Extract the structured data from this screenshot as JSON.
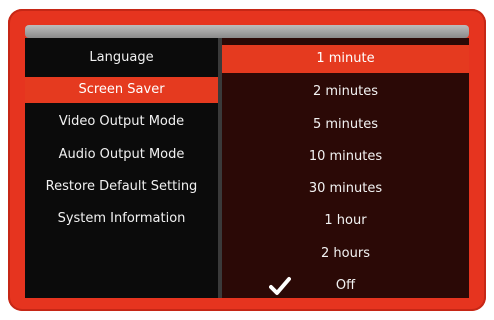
{
  "colors": {
    "frame": "#e6341f",
    "highlight": "#e53a1f",
    "left_panel": "#0b0b0b",
    "right_panel": "#2b0906",
    "text": "#f1f1f1"
  },
  "menu": {
    "items": [
      {
        "label": "Language",
        "selected": false
      },
      {
        "label": "Screen Saver",
        "selected": true
      },
      {
        "label": "Video Output Mode",
        "selected": false
      },
      {
        "label": "Audio Output Mode",
        "selected": false
      },
      {
        "label": "Restore Default Setting",
        "selected": false
      },
      {
        "label": "System Information",
        "selected": false
      }
    ]
  },
  "options": {
    "items": [
      {
        "label": "1 minute",
        "highlighted": true,
        "checked": false
      },
      {
        "label": "2 minutes",
        "highlighted": false,
        "checked": false
      },
      {
        "label": "5 minutes",
        "highlighted": false,
        "checked": false
      },
      {
        "label": "10 minutes",
        "highlighted": false,
        "checked": false
      },
      {
        "label": "30 minutes",
        "highlighted": false,
        "checked": false
      },
      {
        "label": "1 hour",
        "highlighted": false,
        "checked": false
      },
      {
        "label": "2 hours",
        "highlighted": false,
        "checked": false
      },
      {
        "label": "Off",
        "highlighted": false,
        "checked": true
      }
    ],
    "check_icon": "checkmark-icon"
  }
}
